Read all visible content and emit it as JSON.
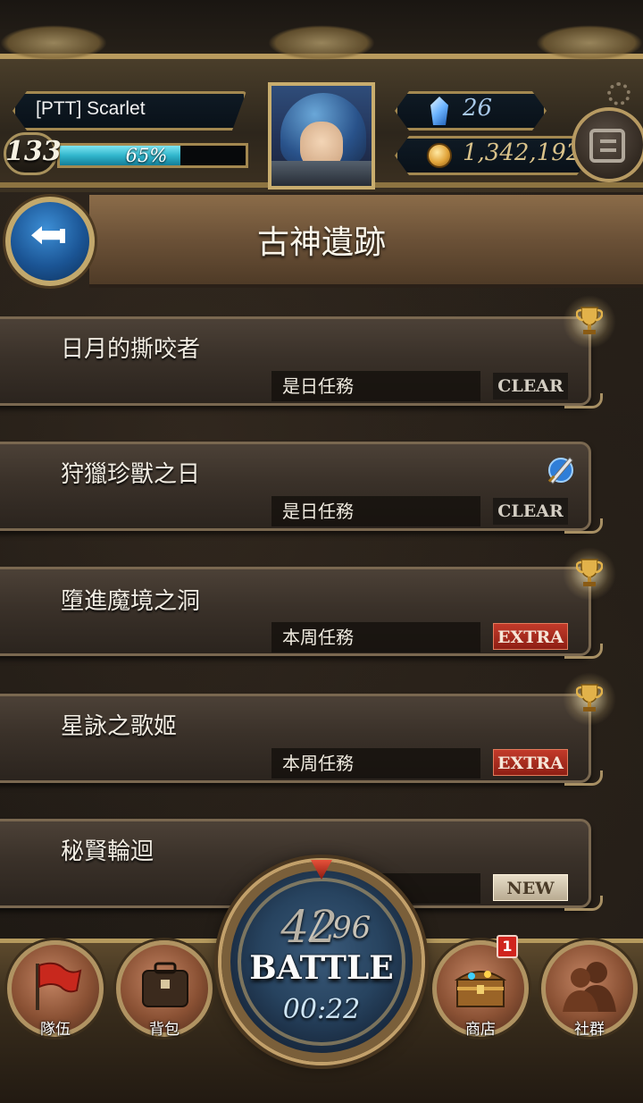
{
  "header": {
    "player_name": "[PTT] Scarlet",
    "level": "133",
    "exp_percent_text": "65%",
    "exp_fraction": 0.65,
    "gems": "26",
    "gold": "1,342,192"
  },
  "title": "古神遺跡",
  "quests": [
    {
      "name": "日月的撕咬者",
      "type": "是日任務",
      "status": "CLEAR",
      "icon": "trophy-icon"
    },
    {
      "name": "狩獵珍獸之日",
      "type": "是日任務",
      "status": "CLEAR",
      "icon": "sword-icon"
    },
    {
      "name": "墮進魔境之洞",
      "type": "本周任務",
      "status": "EXTRA",
      "icon": "trophy-icon"
    },
    {
      "name": "星詠之歌姬",
      "type": "本周任務",
      "status": "EXTRA",
      "icon": "trophy-icon"
    },
    {
      "name": "秘賢輪迴",
      "type": "",
      "status": "NEW",
      "icon": ""
    }
  ],
  "nav": {
    "team_label": "隊伍",
    "bag_label": "背包",
    "shop_label": "商店",
    "social_label": "社群",
    "shop_badge": "1"
  },
  "battle": {
    "stamina_current": "42",
    "stamina_max": "96",
    "label": "BATTLE",
    "timer": "00:22"
  },
  "colors": {
    "extra_badge": "#c23a2a",
    "exp_fill": "#31b6cc",
    "back_button": "#1b5595"
  }
}
